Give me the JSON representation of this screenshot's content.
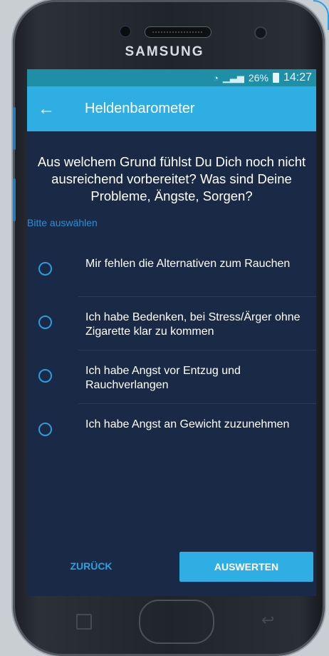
{
  "device": {
    "brand": "SAMSUNG"
  },
  "statusbar": {
    "battery": "26%",
    "time": "14:27"
  },
  "appbar": {
    "title": "Heldenbarometer"
  },
  "question": {
    "text": "Aus welchem Grund fühlst Du Dich noch nicht ausreichend vorbereitet? Was sind Deine Probleme, Ängste, Sorgen?"
  },
  "hint": "Bitte auswählen",
  "options": [
    {
      "label": "Mir fehlen die Alternativen zum Rauchen",
      "selected": false
    },
    {
      "label": "Ich habe Bedenken, bei Stress/Ärger ohne Zigarette klar zu kommen",
      "selected": false
    },
    {
      "label": "Ich habe Angst vor Entzug und Rauchverlangen",
      "selected": false
    },
    {
      "label": "Ich habe Angst an Gewicht zuzunehmen",
      "selected": false
    }
  ],
  "buttons": {
    "back": "ZURÜCK",
    "evaluate": "AUSWERTEN"
  },
  "colors": {
    "accent": "#2faee3",
    "background": "#1a2a46",
    "statusbar": "#1f8fa8"
  }
}
